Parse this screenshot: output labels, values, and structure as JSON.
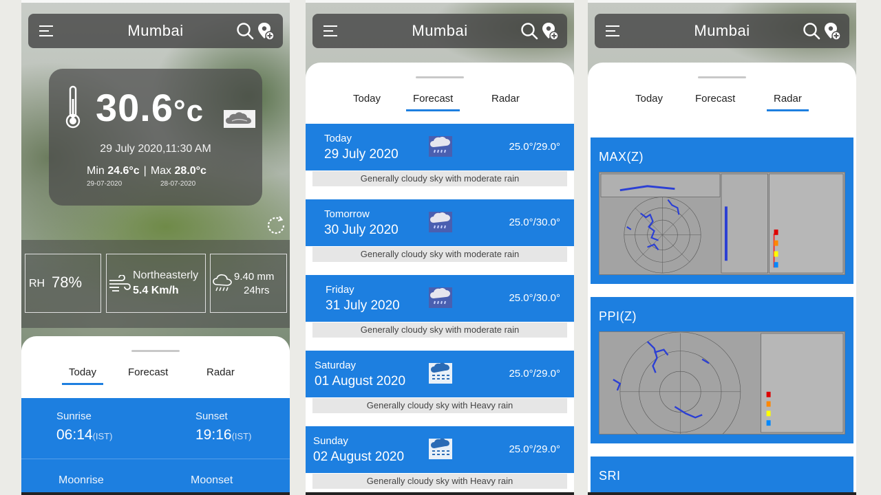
{
  "city": "Mumbai",
  "today": {
    "temperature": "30.6",
    "unit": "°c",
    "datetime": "29 July 2020,11:30 AM",
    "min_label": "Min",
    "min_value": "24.6°c",
    "min_date": "29-07-2020",
    "separator": "|",
    "max_label": "Max",
    "max_value": "28.0°c",
    "max_date": "28-07-2020",
    "rh_label": "RH",
    "rh_value": "78%",
    "wind_direction": "Northeasterly",
    "wind_speed": "5.4 Km/h",
    "rain_amount": "9.40 mm",
    "rain_period": "24hrs",
    "sunrise_label": "Sunrise",
    "sunrise_time": "06:14",
    "sunset_label": "Sunset",
    "sunset_time": "19:16",
    "tz": "(IST)",
    "moonrise_label": "Moonrise",
    "moonset_label": "Moonset"
  },
  "tabs": [
    "Today",
    "Forecast",
    "Radar"
  ],
  "forecast": [
    {
      "day": "Today",
      "date": "29 July 2020",
      "range": "25.0°/29.0°",
      "desc": "Generally cloudy sky with moderate rain",
      "icon": "rain-cloud-icon"
    },
    {
      "day": "Tomorrow",
      "date": "30 July 2020",
      "range": "25.0°/30.0°",
      "desc": "Generally cloudy sky with moderate rain",
      "icon": "rain-cloud-icon"
    },
    {
      "day": "Friday",
      "date": "31 July 2020",
      "range": "25.0°/30.0°",
      "desc": "Generally cloudy sky with moderate rain",
      "icon": "rain-cloud-icon"
    },
    {
      "day": "Saturday",
      "date": "01 August 2020",
      "range": "25.0°/29.0°",
      "desc": "Generally cloudy sky with Heavy rain",
      "icon": "heavy-rain-cloud-icon"
    },
    {
      "day": "Sunday",
      "date": "02 August 2020",
      "range": "25.0°/29.0°",
      "desc": "Generally cloudy sky with Heavy rain",
      "icon": "heavy-rain-cloud-icon"
    }
  ],
  "radar": [
    {
      "title": "MAX(Z)"
    },
    {
      "title": "PPI(Z)"
    },
    {
      "title": "SRI"
    }
  ],
  "colors": {
    "accent": "#1d7fe0",
    "bar": "#464646",
    "desc_bg": "#e6e6e6"
  }
}
